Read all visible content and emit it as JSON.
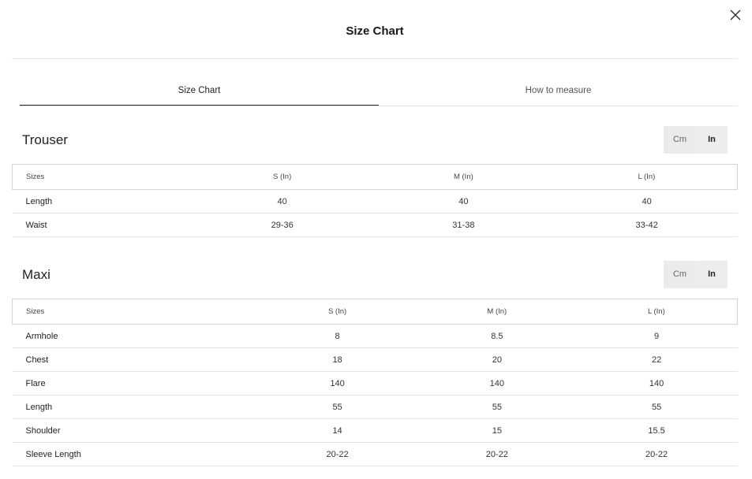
{
  "modal": {
    "title": "Size Chart"
  },
  "tabs": [
    {
      "label": "Size Chart",
      "active": true
    },
    {
      "label": "How to measure",
      "active": false
    }
  ],
  "units": {
    "cm": "Cm",
    "in": "In",
    "selected": "In"
  },
  "sections": [
    {
      "title": "Trouser",
      "headers": [
        "Sizes",
        "S (In)",
        "M (In)",
        "L (In)"
      ],
      "rows": [
        [
          "Length",
          "40",
          "40",
          "40"
        ],
        [
          "Waist",
          "29-36",
          "31-38",
          "33-42"
        ]
      ]
    },
    {
      "title": "Maxi",
      "headers": [
        "Sizes",
        "S (In)",
        "M (In)",
        "L (In)"
      ],
      "rows": [
        [
          "Armhole",
          "8",
          "8.5",
          "9"
        ],
        [
          "Chest",
          "18",
          "20",
          "22"
        ],
        [
          "Flare",
          "140",
          "140",
          "140"
        ],
        [
          "Length",
          "55",
          "55",
          "55"
        ],
        [
          "Shoulder",
          "14",
          "15",
          "15.5"
        ],
        [
          "Sleeve Length",
          "20-22",
          "20-22",
          "20-22"
        ]
      ]
    }
  ]
}
